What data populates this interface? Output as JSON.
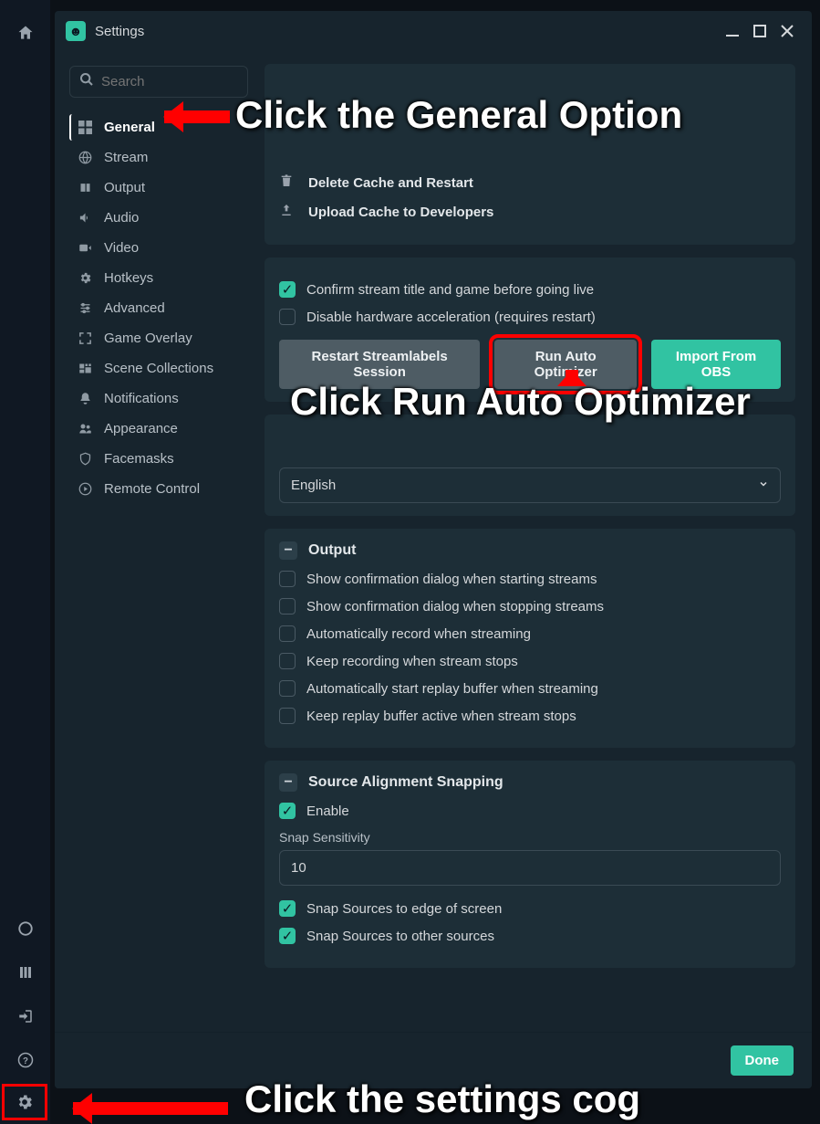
{
  "titlebar": {
    "title": "Settings"
  },
  "search": {
    "placeholder": "Search"
  },
  "sidebar": {
    "items": [
      {
        "label": "General",
        "icon": "grid-icon",
        "active": true
      },
      {
        "label": "Stream",
        "icon": "globe-icon"
      },
      {
        "label": "Output",
        "icon": "output-icon"
      },
      {
        "label": "Audio",
        "icon": "speaker-icon"
      },
      {
        "label": "Video",
        "icon": "video-icon"
      },
      {
        "label": "Hotkeys",
        "icon": "gear-icon"
      },
      {
        "label": "Advanced",
        "icon": "sliders-icon"
      },
      {
        "label": "Game Overlay",
        "icon": "expand-icon"
      },
      {
        "label": "Scene Collections",
        "icon": "scenes-icon"
      },
      {
        "label": "Notifications",
        "icon": "bell-icon"
      },
      {
        "label": "Appearance",
        "icon": "users-icon"
      },
      {
        "label": "Facemasks",
        "icon": "shield-icon"
      },
      {
        "label": "Remote Control",
        "icon": "play-circle-icon"
      }
    ]
  },
  "panels": {
    "cache": {
      "delete_label": "Delete Cache and Restart",
      "upload_label": "Upload Cache to Developers"
    },
    "opts": {
      "confirm_title": "Confirm stream title and game before going live",
      "disable_hw": "Disable hardware acceleration (requires restart)",
      "buttons": {
        "restart": "Restart Streamlabels Session",
        "optimize": "Run Auto Optimizer",
        "import": "Import From OBS"
      }
    },
    "language": {
      "value": "English"
    },
    "output": {
      "title": "Output",
      "items": [
        "Show confirmation dialog when starting streams",
        "Show confirmation dialog when stopping streams",
        "Automatically record when streaming",
        "Keep recording when stream stops",
        "Automatically start replay buffer when streaming",
        "Keep replay buffer active when stream stops"
      ]
    },
    "snapping": {
      "title": "Source Alignment Snapping",
      "enable_label": "Enable",
      "sensitivity_label": "Snap Sensitivity",
      "sensitivity_value": "10",
      "snap_edge": "Snap Sources to edge of screen",
      "snap_other": "Snap Sources to other sources"
    }
  },
  "footer": {
    "done_label": "Done"
  },
  "callouts": {
    "general": "Click the General Option",
    "optimizer": "Click Run Auto Optimizer",
    "cog": "Click the settings cog"
  }
}
